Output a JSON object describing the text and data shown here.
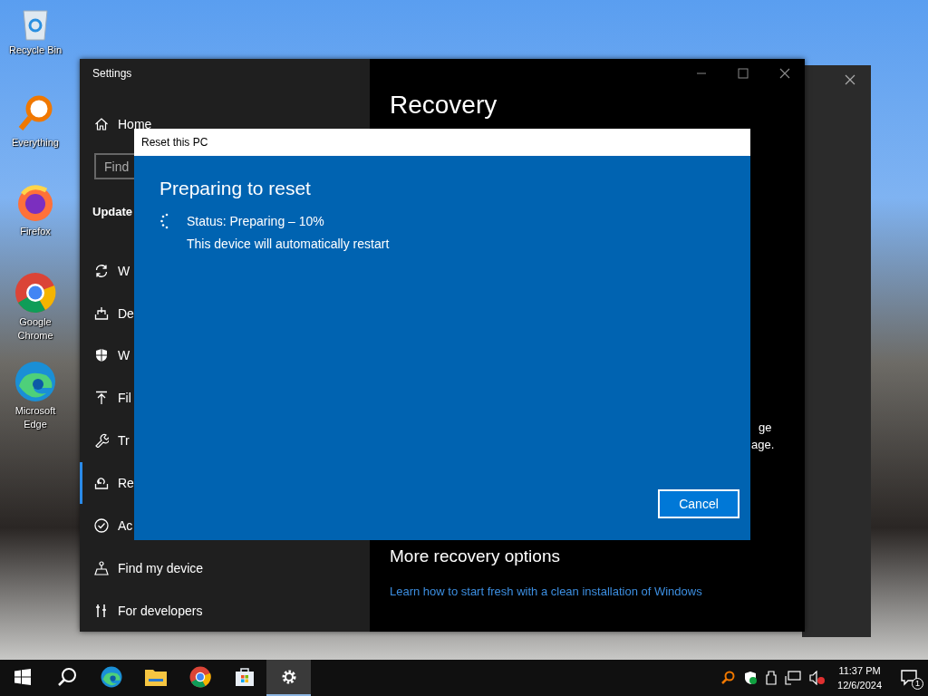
{
  "desktop_icons": [
    {
      "label": "Recycle Bin",
      "kind": "recycle"
    },
    {
      "label": "Everything",
      "kind": "everything"
    },
    {
      "label": "Firefox",
      "kind": "firefox"
    },
    {
      "label": "Google Chrome",
      "kind": "chrome"
    },
    {
      "label": "Microsoft Edge",
      "kind": "edge"
    }
  ],
  "settings": {
    "title": "Settings",
    "home": "Home",
    "search": {
      "placeholder": "Find"
    },
    "section_heading": "Update",
    "nav": [
      {
        "label": "W",
        "kind": "sync",
        "selected": false
      },
      {
        "label": "De",
        "kind": "delivery",
        "selected": false
      },
      {
        "label": "W",
        "kind": "shield",
        "selected": false
      },
      {
        "label": "Fil",
        "kind": "upload",
        "selected": false
      },
      {
        "label": "Tr",
        "kind": "wrench",
        "selected": false
      },
      {
        "label": "Re",
        "kind": "recovery",
        "selected": true
      },
      {
        "label": "Ac",
        "kind": "check",
        "selected": false
      },
      {
        "label": "Find my device",
        "kind": "person",
        "selected": false
      },
      {
        "label": "For developers",
        "kind": "tools",
        "selected": false
      }
    ],
    "page_title": "Recovery",
    "fragments": [
      "ge",
      "age."
    ],
    "more_heading": "More recovery options",
    "link": "Learn how to start fresh with a clean installation of Windows"
  },
  "dialog": {
    "title": "Reset this PC",
    "heading": "Preparing to reset",
    "status": "Status: Preparing – 10%",
    "note": "This device will automatically restart",
    "button": "Cancel"
  },
  "taskbar": {
    "apps": [
      {
        "kind": "start",
        "selected": false
      },
      {
        "kind": "search",
        "selected": false
      },
      {
        "kind": "edge",
        "selected": false
      },
      {
        "kind": "folder",
        "selected": false
      },
      {
        "kind": "chrome",
        "selected": false
      },
      {
        "kind": "store",
        "selected": false
      },
      {
        "kind": "settings",
        "selected": true
      }
    ],
    "time": "11:37 PM",
    "date": "12/6/2024",
    "notification_count": "1"
  }
}
